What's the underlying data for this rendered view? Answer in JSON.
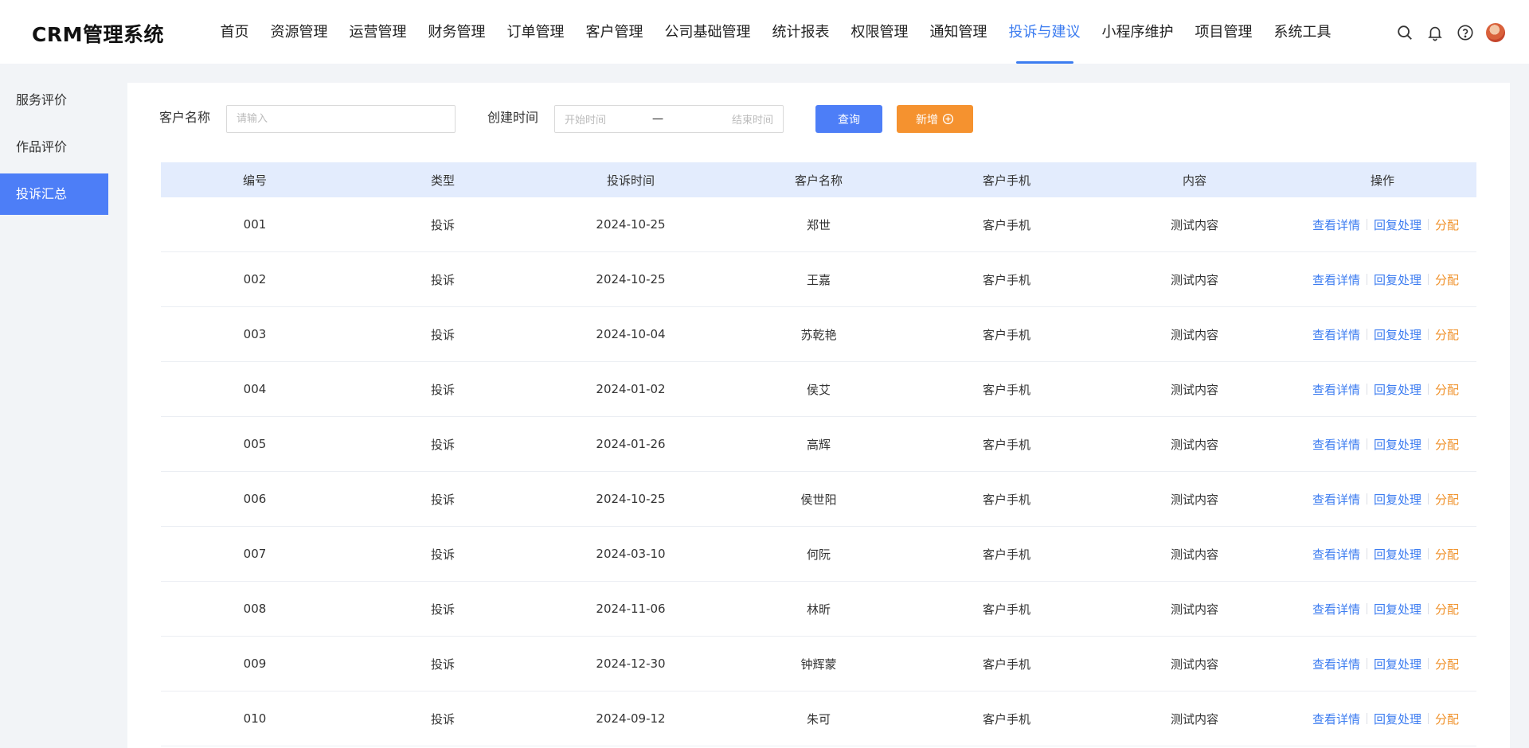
{
  "app": {
    "title": "CRM管理系统"
  },
  "nav": {
    "items": [
      {
        "label": "首页"
      },
      {
        "label": "资源管理"
      },
      {
        "label": "运营管理"
      },
      {
        "label": "财务管理"
      },
      {
        "label": "订单管理"
      },
      {
        "label": "客户管理"
      },
      {
        "label": "公司基础管理"
      },
      {
        "label": "统计报表"
      },
      {
        "label": "权限管理"
      },
      {
        "label": "通知管理"
      },
      {
        "label": "投诉与建议",
        "active": true
      },
      {
        "label": "小程序维护"
      },
      {
        "label": "项目管理"
      },
      {
        "label": "系统工具"
      }
    ]
  },
  "header_icons": [
    "search-icon",
    "bell-icon",
    "help-icon",
    "avatar"
  ],
  "sidebar": {
    "items": [
      {
        "label": "服务评价"
      },
      {
        "label": "作品评价"
      },
      {
        "label": "投诉汇总",
        "active": true
      }
    ]
  },
  "filters": {
    "customer_label": "客户名称",
    "customer_placeholder": "请输入",
    "created_label": "创建时间",
    "start_placeholder": "开始时间",
    "range_separator": "一",
    "end_placeholder": "结束时间",
    "query_label": "查询",
    "add_label": "新增"
  },
  "table": {
    "columns": [
      "编号",
      "类型",
      "投诉时间",
      "客户名称",
      "客户手机",
      "内容",
      "操作"
    ],
    "actions": {
      "view": "查看详情",
      "reply": "回复处理",
      "assign": "分配"
    },
    "rows": [
      {
        "id": "001",
        "type": "投诉",
        "time": "2024-10-25",
        "name": "郑世",
        "phone": "客户手机",
        "content": "测试内容"
      },
      {
        "id": "002",
        "type": "投诉",
        "time": "2024-10-25",
        "name": "王嘉",
        "phone": "客户手机",
        "content": "测试内容"
      },
      {
        "id": "003",
        "type": "投诉",
        "time": "2024-10-04",
        "name": "苏乾艳",
        "phone": "客户手机",
        "content": "测试内容"
      },
      {
        "id": "004",
        "type": "投诉",
        "time": "2024-01-02",
        "name": "侯艾",
        "phone": "客户手机",
        "content": "测试内容"
      },
      {
        "id": "005",
        "type": "投诉",
        "time": "2024-01-26",
        "name": "高辉",
        "phone": "客户手机",
        "content": "测试内容"
      },
      {
        "id": "006",
        "type": "投诉",
        "time": "2024-10-25",
        "name": "侯世阳",
        "phone": "客户手机",
        "content": "测试内容"
      },
      {
        "id": "007",
        "type": "投诉",
        "time": "2024-03-10",
        "name": "何阮",
        "phone": "客户手机",
        "content": "测试内容"
      },
      {
        "id": "008",
        "type": "投诉",
        "time": "2024-11-06",
        "name": "林昕",
        "phone": "客户手机",
        "content": "测试内容"
      },
      {
        "id": "009",
        "type": "投诉",
        "time": "2024-12-30",
        "name": "钟辉蒙",
        "phone": "客户手机",
        "content": "测试内容"
      },
      {
        "id": "010",
        "type": "投诉",
        "time": "2024-09-12",
        "name": "朱可",
        "phone": "客户手机",
        "content": "测试内容"
      }
    ]
  },
  "colors": {
    "primary": "#4d7ef7",
    "link": "#3c7cf0",
    "orange": "#f5922f",
    "table_header": "#e3ecfd"
  }
}
